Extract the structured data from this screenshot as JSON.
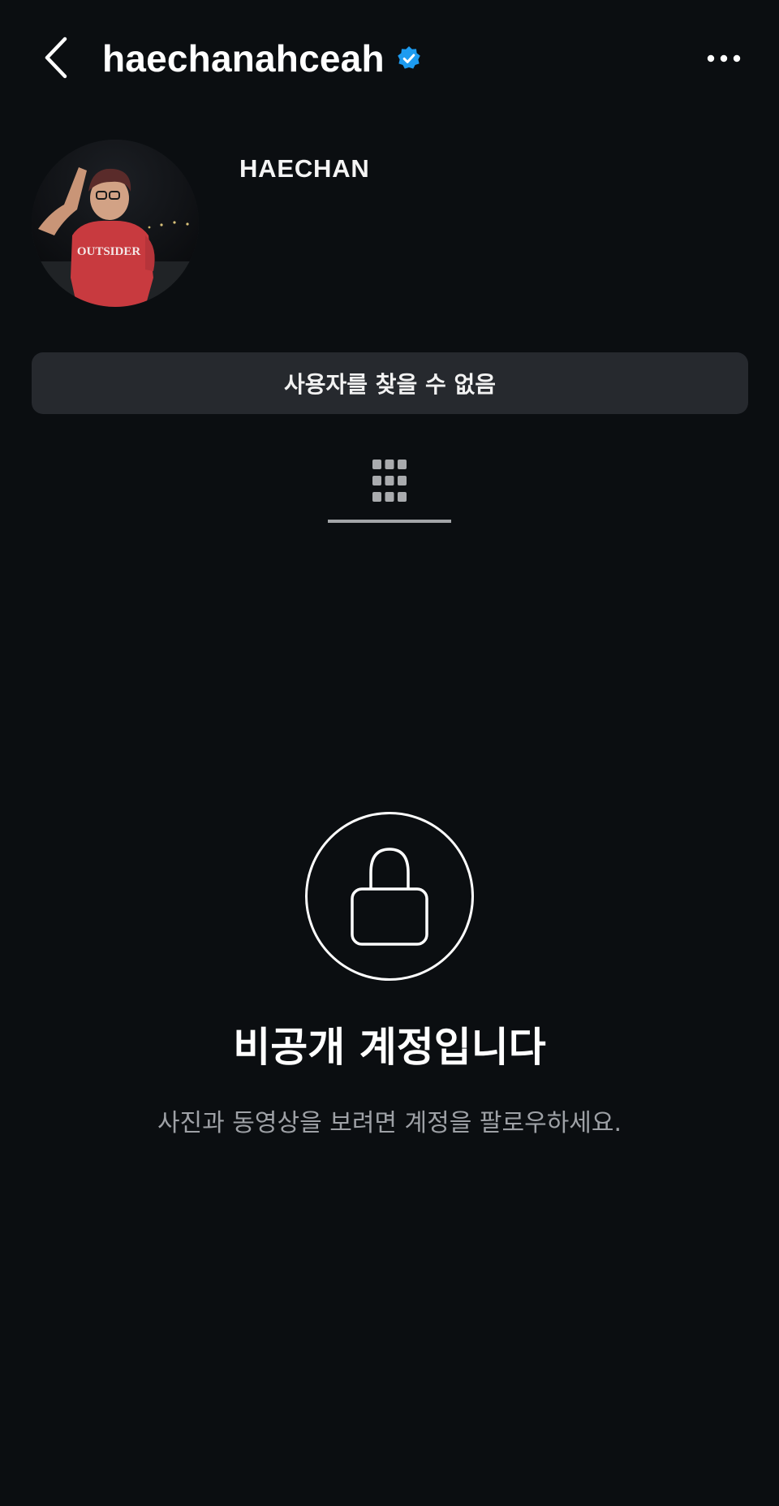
{
  "header": {
    "username": "haechanahceah",
    "verified": true,
    "back_icon": "chevron-left-icon",
    "more_icon": "more-horizontal-icon",
    "verified_color": "#1d9bf0"
  },
  "profile": {
    "display_name": "HAECHAN",
    "avatar_shirt_text": "OUTSIDER"
  },
  "status_button": {
    "label": "사용자를 찾을 수 없음"
  },
  "tabs": [
    {
      "icon": "grid-icon",
      "active": true
    }
  ],
  "private_notice": {
    "title": "비공개 계정입니다",
    "subtitle": "사진과 동영상을 보려면 계정을 팔로우하세요.",
    "icon": "lock-icon"
  },
  "colors": {
    "background": "#0b0e11",
    "button_bg": "#26292e",
    "secondary_text": "#9ea1a6"
  }
}
